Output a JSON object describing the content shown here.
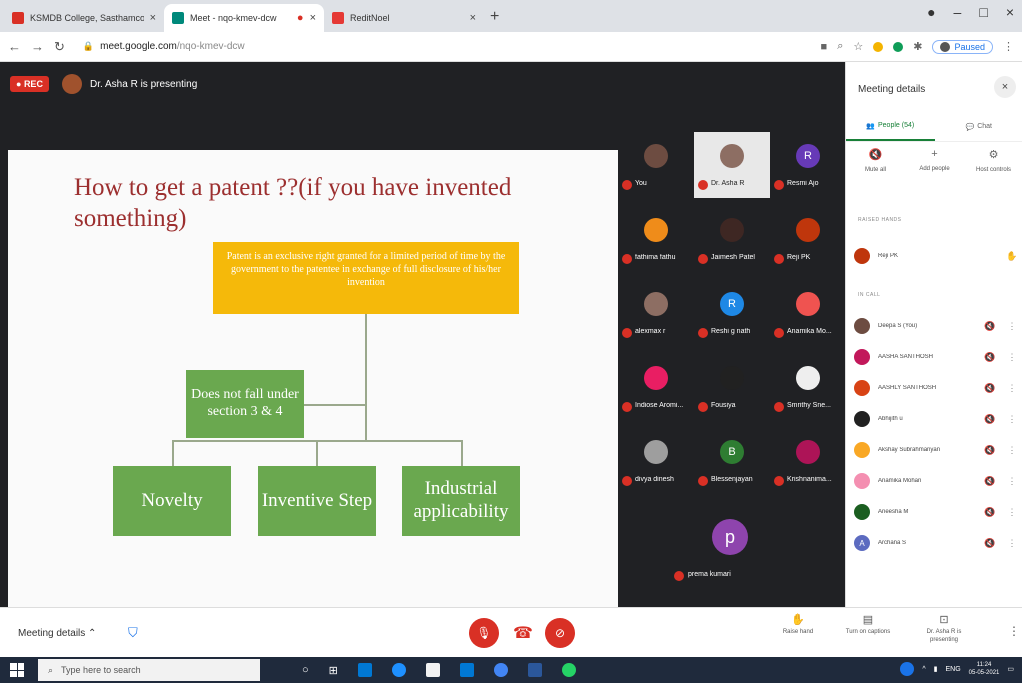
{
  "browser": {
    "tabs": [
      {
        "title": "KSMDB College, Sasthamcotta I",
        "fav_color": "#d93025",
        "active": false
      },
      {
        "title": "Meet - nqo-kmev-dcw",
        "fav_color": "#00897b",
        "active": true
      },
      {
        "title": "ReditNoel",
        "fav_color": "#e53935",
        "active": false
      }
    ],
    "url_host": "meet.google.com",
    "url_path": "/nqo-kmev-dcw",
    "paused_label": "Paused"
  },
  "meet": {
    "rec_label": "REC",
    "presenting_text": "Dr. Asha R is presenting",
    "slide": {
      "title": "How to get a patent ??(if you have invented something)",
      "definition": "Patent is an exclusive right granted for a limited period of time by the government to the patentee in exchange of full disclosure of his/her invention",
      "section_box": "Does not fall under section 3 & 4",
      "criteria": [
        "Novelty",
        "Inventive Step",
        "Industrial applicability"
      ]
    },
    "tiles": [
      {
        "name": "You",
        "color": "#6d4c41",
        "initial": "",
        "video": false
      },
      {
        "name": "Dr. Asha R",
        "color": "#8d6e63",
        "initial": "",
        "video": true
      },
      {
        "name": "Resmi Ajo",
        "color": "#673ab7",
        "initial": "R",
        "video": false
      },
      {
        "name": "fathima fathu",
        "color": "#ef8c1a",
        "initial": "",
        "video": false
      },
      {
        "name": "Jaimesh Patel",
        "color": "#3e2723",
        "initial": "",
        "video": false
      },
      {
        "name": "Reji PK",
        "color": "#bf360c",
        "initial": "",
        "video": false
      },
      {
        "name": "alexmax r",
        "color": "#8d6e63",
        "initial": "",
        "video": false
      },
      {
        "name": "Reshi g nath",
        "color": "#1e88e5",
        "initial": "R",
        "video": false
      },
      {
        "name": "Anamika Mo...",
        "color": "#ef5350",
        "initial": "",
        "video": false
      },
      {
        "name": "Indiose Aromi...",
        "color": "#e91e63",
        "initial": "",
        "video": false
      },
      {
        "name": "Fousiya",
        "color": "#212121",
        "initial": "",
        "video": false
      },
      {
        "name": "Smrithy Sne...",
        "color": "#eeeeee",
        "initial": "",
        "video": false
      },
      {
        "name": "divya dinesh",
        "color": "#9e9e9e",
        "initial": "",
        "video": false
      },
      {
        "name": "Blessenjayan",
        "color": "#2e7d32",
        "initial": "B",
        "video": false
      },
      {
        "name": "Krishnanima...",
        "color": "#ad1457",
        "initial": "",
        "video": false
      }
    ],
    "big_tile": {
      "name": "prema kumari",
      "initial": "p"
    }
  },
  "panel": {
    "title": "Meeting details",
    "tab_people": "People (54)",
    "tab_chat": "Chat",
    "actions": [
      "Mute all",
      "Add people",
      "Host controls"
    ],
    "raised_label": "RAISED HANDS",
    "raised": [
      {
        "name": "Reji PK",
        "color": "#bf360c"
      }
    ],
    "incall_label": "IN CALL",
    "people": [
      {
        "name": "Deepa S (You)",
        "color": "#6d4c41",
        "initial": ""
      },
      {
        "name": "AASHA SANTHOSH",
        "color": "#c2185b",
        "initial": ""
      },
      {
        "name": "AASHLY SANTHOSH",
        "color": "#d84315",
        "initial": ""
      },
      {
        "name": "Abhijith u",
        "color": "#212121",
        "initial": ""
      },
      {
        "name": "Akshay Subrahmanyan",
        "color": "#f9a825",
        "initial": ""
      },
      {
        "name": "Anamika Mohan",
        "color": "#f48fb1",
        "initial": ""
      },
      {
        "name": "Aneesha M",
        "color": "#1b5e20",
        "initial": ""
      },
      {
        "name": "Archana S",
        "color": "#5c6bc0",
        "initial": "A"
      }
    ]
  },
  "bottombar": {
    "meeting_details": "Meeting details",
    "raise_hand": "Raise hand",
    "captions": "Turn on captions",
    "presenting": "Dr. Asha R is presenting"
  },
  "taskbar": {
    "search_placeholder": "Type here to search",
    "lang": "ENG",
    "time": "11:24",
    "date": "05-05-2021"
  }
}
